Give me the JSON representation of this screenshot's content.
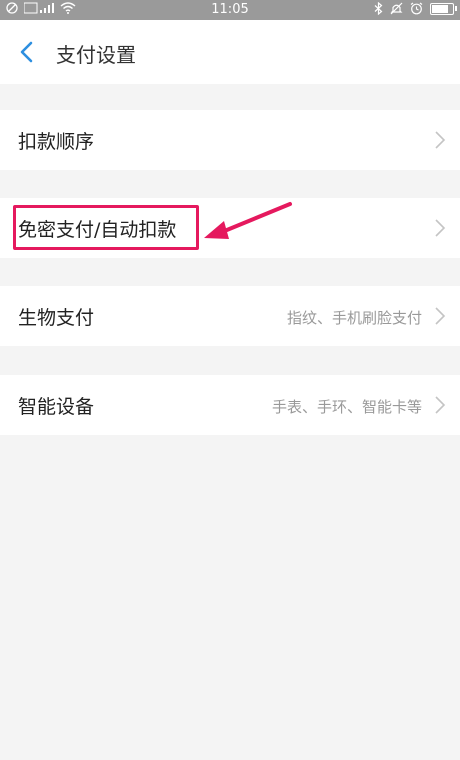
{
  "status_bar": {
    "time": "11:05",
    "left_icons": [
      "no-sim-icon",
      "signal-icon",
      "wifi-icon"
    ],
    "right_icons": [
      "bluetooth-icon",
      "mute-icon",
      "alarm-icon",
      "battery-icon"
    ],
    "battery_level": 0.8
  },
  "header": {
    "back_icon": "chevron-left-icon",
    "title": "支付设置"
  },
  "menu": [
    {
      "label": "扣款顺序",
      "value": ""
    },
    {
      "label": "免密支付/自动扣款",
      "value": ""
    },
    {
      "label": "生物支付",
      "value": "指纹、手机刷脸支付"
    },
    {
      "label": "智能设备",
      "value": "手表、手环、智能卡等"
    }
  ],
  "annotation": {
    "highlight_color": "#e5195e",
    "highlighted_item": "免密支付/自动扣款"
  }
}
